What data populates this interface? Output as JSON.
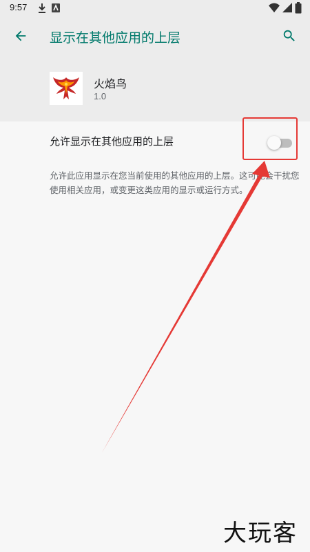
{
  "status_bar": {
    "time": "9:57"
  },
  "toolbar": {
    "title": "显示在其他应用的上层",
    "back_icon": "arrow-left-icon",
    "search_icon": "search-icon"
  },
  "app": {
    "name": "火焰鸟",
    "version": "1.0",
    "icon": "phoenix-logo-icon"
  },
  "preference": {
    "title": "允许显示在其他应用的上层",
    "enabled": false,
    "summary": "允许此应用显示在您当前使用的其他应用的上层。这可能会干扰您使用相关应用，或变更这类应用的显示或运行方式。"
  },
  "annotation": {
    "color": "#e53935"
  },
  "watermark": {
    "text": "大玩客"
  },
  "colors": {
    "accent": "#00796b",
    "header_bg": "#ececec",
    "page_bg": "#f7f7f7"
  }
}
